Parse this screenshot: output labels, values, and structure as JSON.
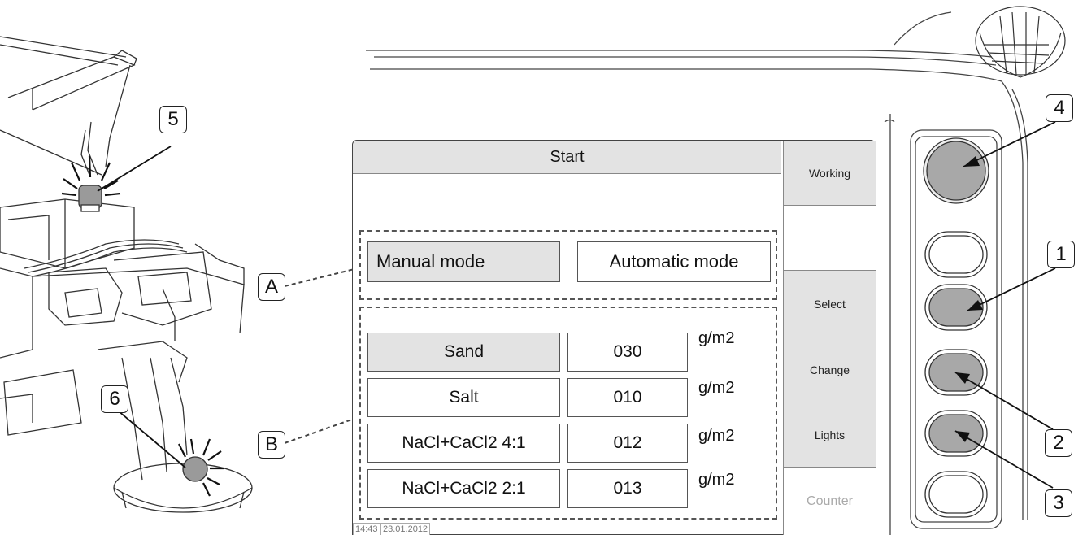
{
  "screen": {
    "title": "Start",
    "softkeys": [
      {
        "label": "Working",
        "state": "filled"
      },
      {
        "label": "",
        "state": "blank"
      },
      {
        "label": "Select",
        "state": "filled"
      },
      {
        "label": "Change",
        "state": "filled"
      },
      {
        "label": "Lights",
        "state": "filled"
      },
      {
        "label": "Counter",
        "state": "disabled"
      }
    ],
    "modes": {
      "manual": "Manual mode",
      "automatic": "Automatic mode",
      "selected": "manual"
    },
    "materials": [
      {
        "name": "Sand",
        "value": "030",
        "unit": "g/m2",
        "selected": true
      },
      {
        "name": "Salt",
        "value": "010",
        "unit": "g/m2",
        "selected": false
      },
      {
        "name": "NaCl+CaCl2 4:1",
        "value": "012",
        "unit": "g/m2",
        "selected": false
      },
      {
        "name": "NaCl+CaCl2 2:1",
        "value": "013",
        "unit": "g/m2",
        "selected": false
      }
    ],
    "status": {
      "time": "14:43",
      "date": "23.01.2012"
    }
  },
  "callouts": {
    "A": "A",
    "B": "B",
    "n1": "1",
    "n2": "2",
    "n3": "3",
    "n4": "4",
    "n5": "5",
    "n6": "6"
  },
  "colors": {
    "selected_fill": "#e3e3e3",
    "button_fill": "#a8a8a8",
    "line": "#333333"
  }
}
